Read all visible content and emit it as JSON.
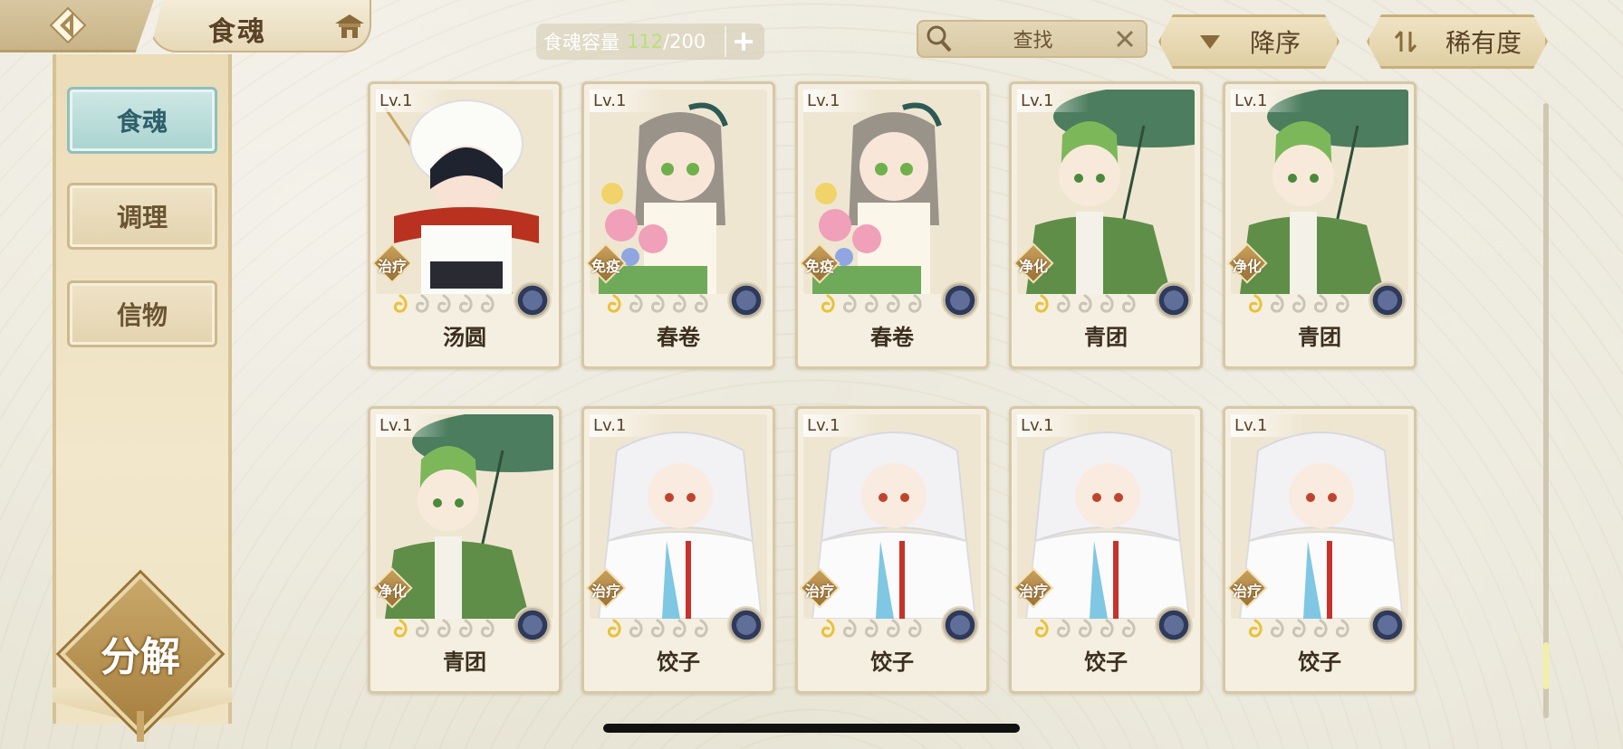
{
  "header": {
    "title": "食魂",
    "capacity": {
      "label": "食魂容量",
      "current": "112",
      "max": "200",
      "sep": "/"
    },
    "search": {
      "placeholder": "查找"
    },
    "sort_order": "降序",
    "sort_by": "稀有度"
  },
  "sidebar": {
    "tabs": [
      {
        "label": "食魂",
        "active": true
      },
      {
        "label": "调理",
        "active": false
      },
      {
        "label": "信物",
        "active": false
      }
    ],
    "decompose": "分解"
  },
  "cards": [
    {
      "lv": "Lv.1",
      "name": "汤圆",
      "trait": "治疗",
      "stars_lit": 1,
      "stars_total": 5,
      "art": "tangyuan"
    },
    {
      "lv": "Lv.1",
      "name": "春卷",
      "trait": "免疫",
      "stars_lit": 1,
      "stars_total": 5,
      "art": "chunjuan"
    },
    {
      "lv": "Lv.1",
      "name": "春卷",
      "trait": "免疫",
      "stars_lit": 1,
      "stars_total": 5,
      "art": "chunjuan"
    },
    {
      "lv": "Lv.1",
      "name": "青团",
      "trait": "净化",
      "stars_lit": 1,
      "stars_total": 5,
      "art": "qingtuan"
    },
    {
      "lv": "Lv.1",
      "name": "青团",
      "trait": "净化",
      "stars_lit": 1,
      "stars_total": 5,
      "art": "qingtuan"
    },
    {
      "lv": "Lv.1",
      "name": "青团",
      "trait": "净化",
      "stars_lit": 1,
      "stars_total": 5,
      "art": "qingtuan"
    },
    {
      "lv": "Lv.1",
      "name": "饺子",
      "trait": "治疗",
      "stars_lit": 1,
      "stars_total": 5,
      "art": "jiaozi"
    },
    {
      "lv": "Lv.1",
      "name": "饺子",
      "trait": "治疗",
      "stars_lit": 1,
      "stars_total": 5,
      "art": "jiaozi"
    },
    {
      "lv": "Lv.1",
      "name": "饺子",
      "trait": "治疗",
      "stars_lit": 1,
      "stars_total": 5,
      "art": "jiaozi"
    },
    {
      "lv": "Lv.1",
      "name": "饺子",
      "trait": "治疗",
      "stars_lit": 1,
      "stars_total": 5,
      "art": "jiaozi"
    }
  ],
  "scroll": {
    "position": 0.95
  },
  "icons": {
    "back": "back-arrow-icon",
    "home": "house-icon",
    "search": "magnifier-icon",
    "clear": "close-icon",
    "sort_desc": "triangle-down-icon",
    "sort_rarity": "swap-icon"
  },
  "colors": {
    "capacity_current": "#b8e07a",
    "active_tab": "#a9d4d1",
    "trait_badge": "#b08a4a"
  }
}
